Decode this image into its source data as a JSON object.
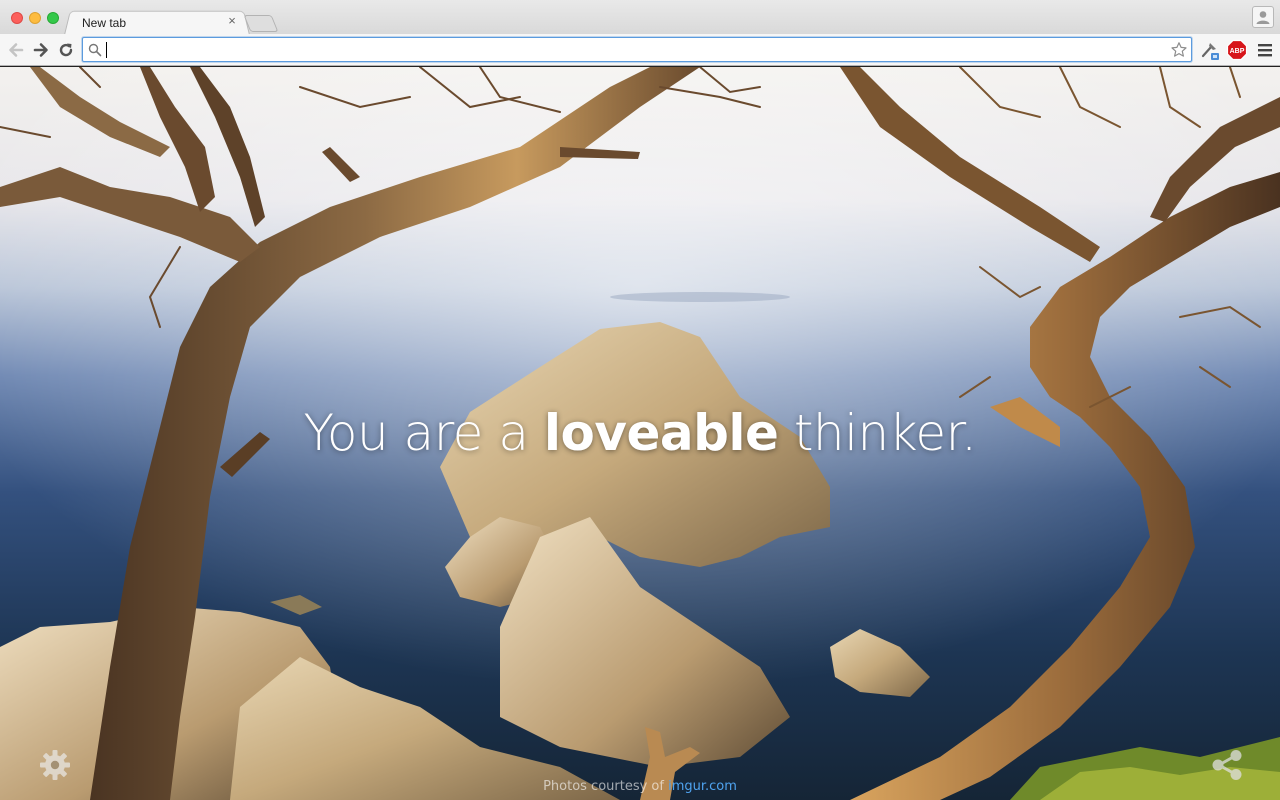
{
  "browser": {
    "tab": {
      "title": "New tab",
      "close_glyph": "×"
    },
    "omnibox": {
      "value": "",
      "placeholder": ""
    },
    "toolbar_icons": [
      "back-icon",
      "forward-icon",
      "reload-icon",
      "search-icon",
      "star-icon",
      "extension-icon",
      "adblock-plus-icon",
      "menu-icon"
    ],
    "abp_badge": "ABP"
  },
  "new_tab_page": {
    "quote": {
      "prefix": "You are a ",
      "emphasis": "loveable",
      "suffix": " thinker."
    },
    "credit": {
      "text": "Photos courtesy of ",
      "link_label": "imgur.com"
    },
    "icons": [
      "gear-icon",
      "share-icon"
    ]
  },
  "colors": {
    "accent_link": "#4fa3ef",
    "omnibox_focus": "#5b9bde",
    "abp_red": "#d7151a"
  }
}
